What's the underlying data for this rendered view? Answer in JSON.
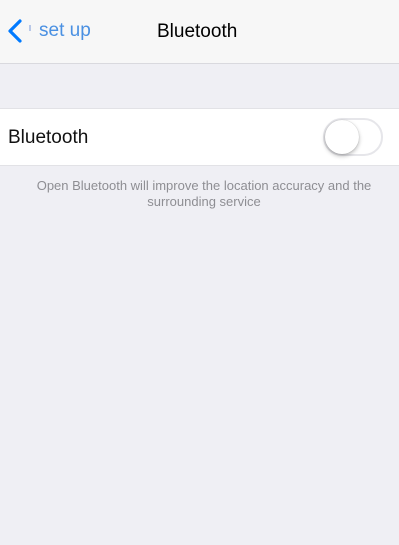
{
  "navbar": {
    "back_label": "set up",
    "title": "Bluetooth"
  },
  "bluetooth_row": {
    "label": "Bluetooth",
    "enabled": false
  },
  "footnote": "Open Bluetooth will improve the location accuracy and the surrounding service",
  "colors": {
    "accent": "#4a90e2",
    "background": "#efeff4",
    "navbar": "#f7f7f7",
    "footnote_text": "#8e8e93"
  },
  "icons": {
    "back": "chevron-left-icon"
  }
}
